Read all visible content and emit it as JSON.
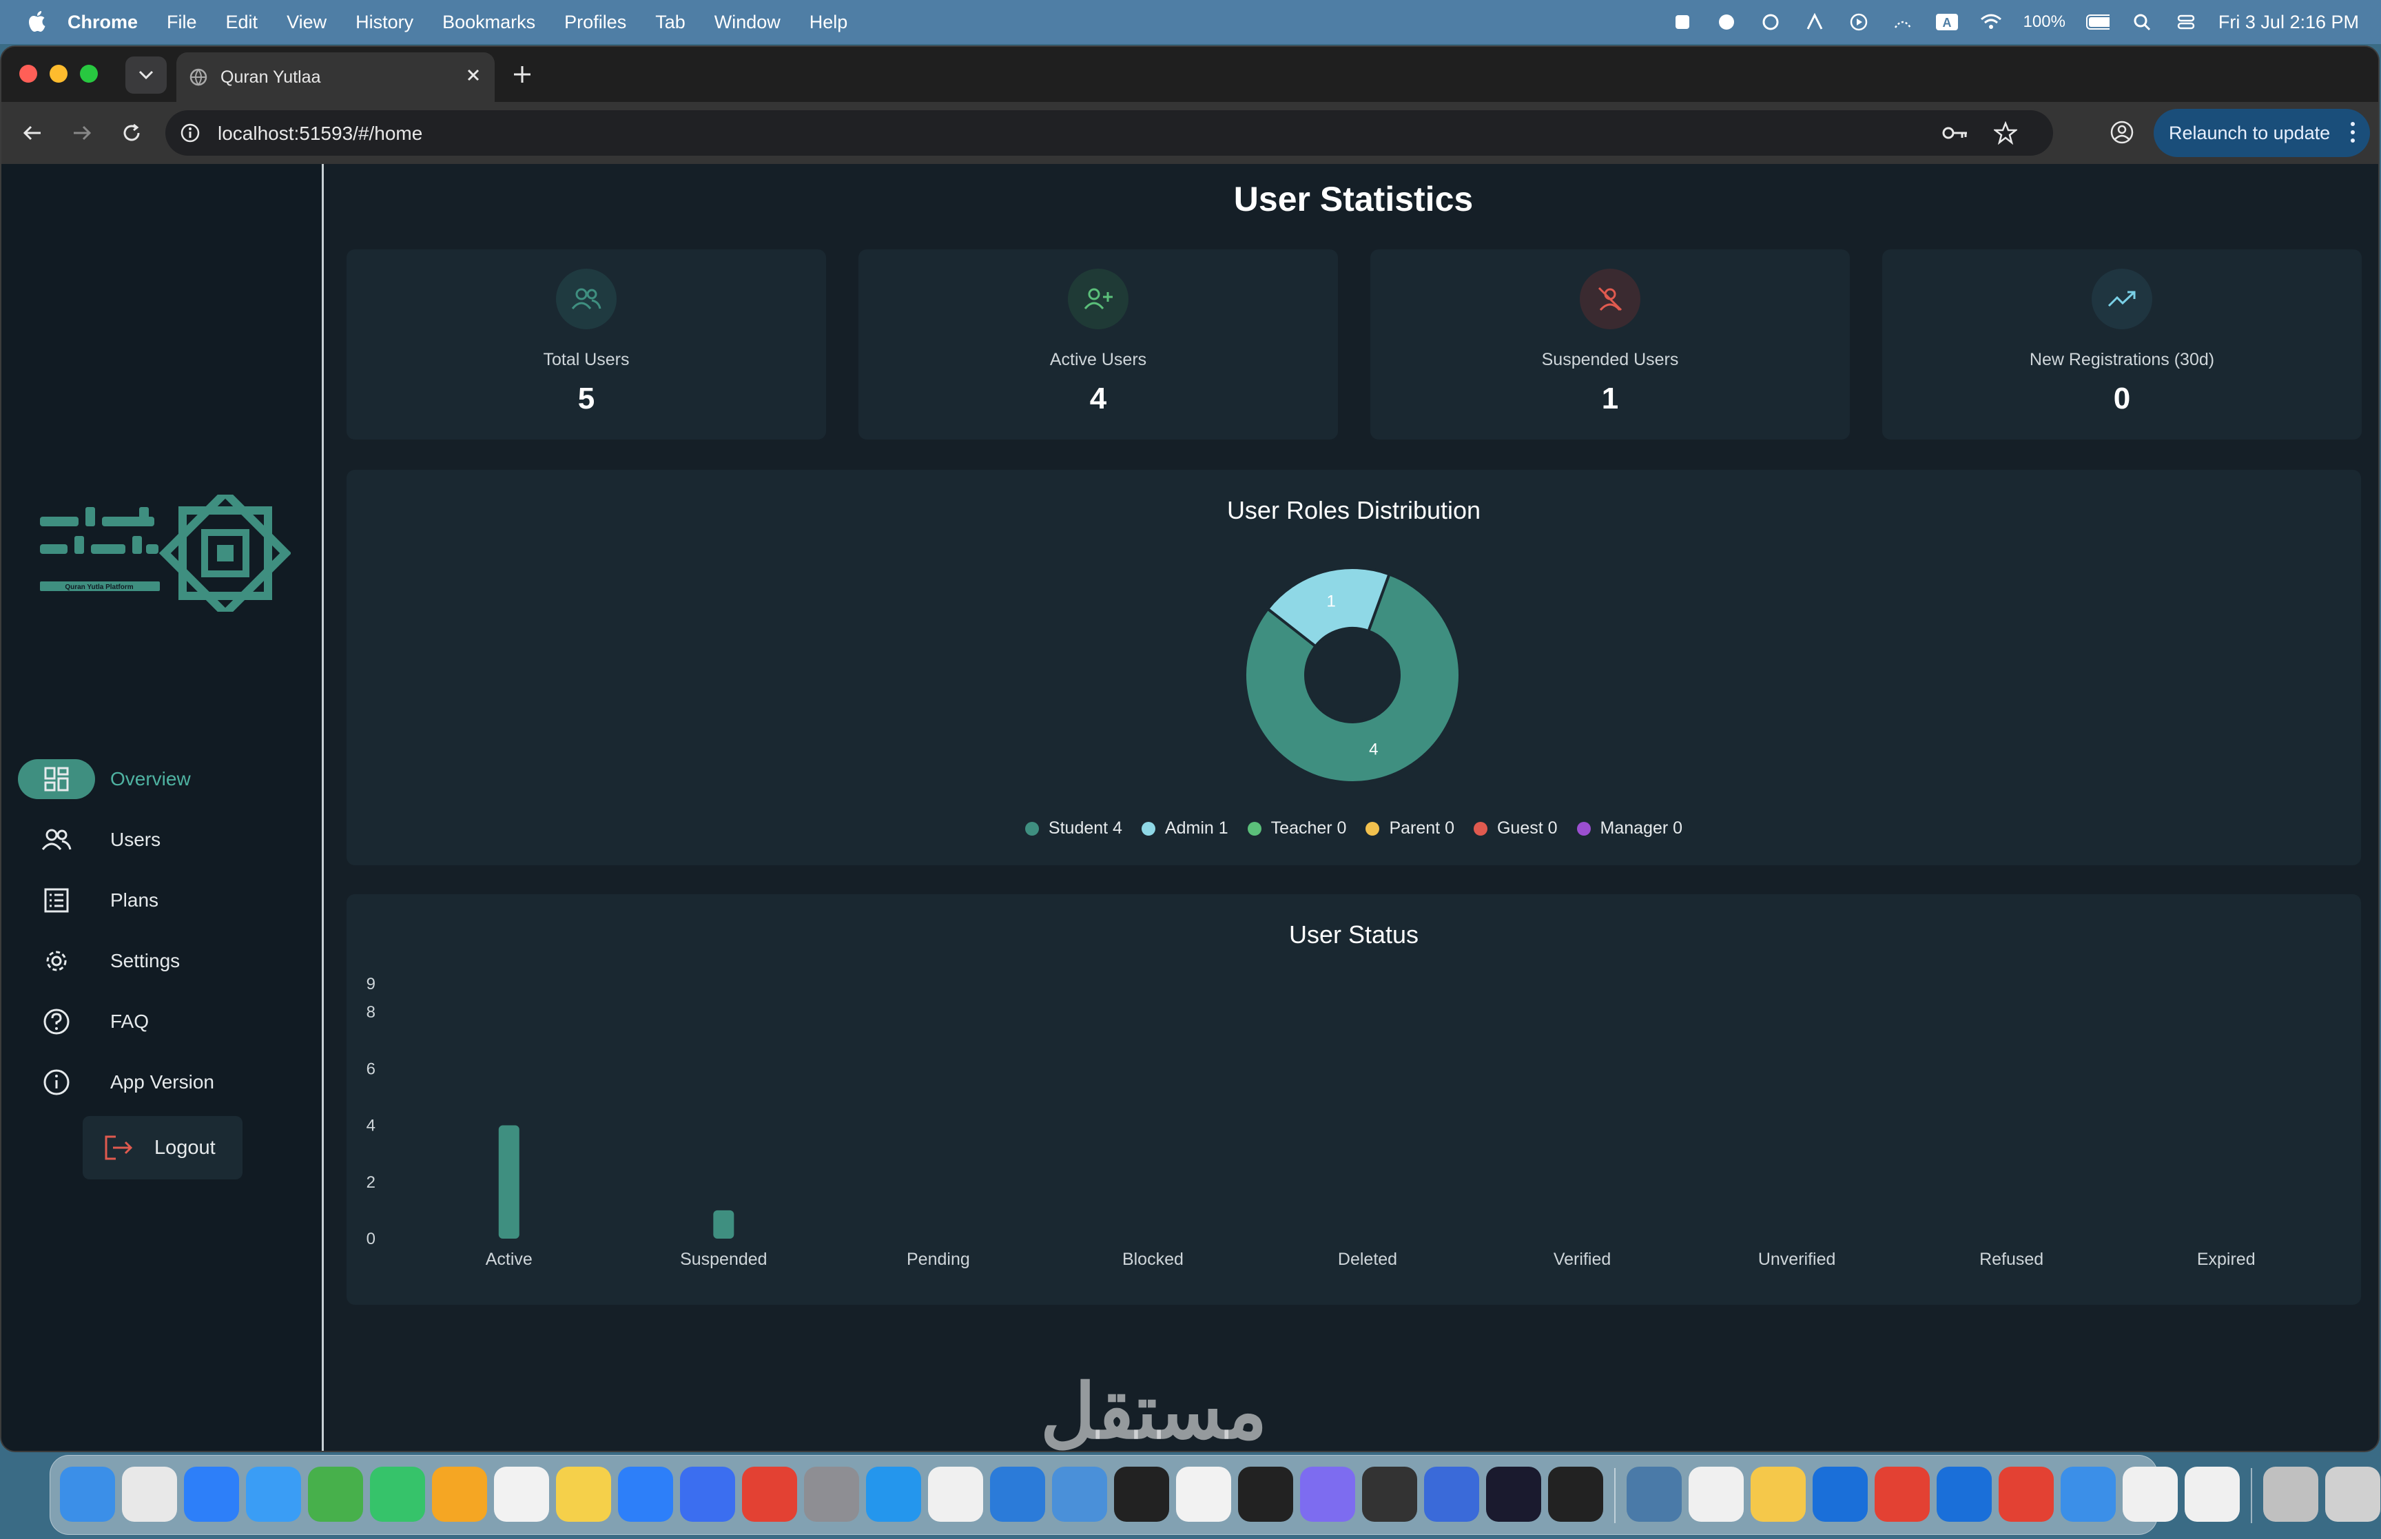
{
  "menubar": {
    "app": "Chrome",
    "menus": [
      "File",
      "Edit",
      "View",
      "History",
      "Bookmarks",
      "Profiles",
      "Tab",
      "Window",
      "Help"
    ],
    "battery": "100%",
    "datetime": "Fri 3 Jul  2:16 PM"
  },
  "browser": {
    "tab_title": "Quran Yutlaa",
    "url": "localhost:51593/#/home",
    "relaunch_label": "Relaunch to update"
  },
  "sidebar": {
    "logo_alt": "Quran Yutla Platform",
    "items": [
      {
        "label": "Overview",
        "icon": "dashboard-icon",
        "active": true
      },
      {
        "label": "Users",
        "icon": "users-icon"
      },
      {
        "label": "Plans",
        "icon": "list-icon"
      },
      {
        "label": "Settings",
        "icon": "gear-icon"
      },
      {
        "label": "FAQ",
        "icon": "help-icon"
      },
      {
        "label": "App Version",
        "icon": "info-icon"
      }
    ],
    "logout_label": "Logout"
  },
  "page": {
    "title": "User Statistics",
    "cards": [
      {
        "label": "Total Users",
        "value": "5",
        "icon": "users-icon",
        "color": "#3f8f80"
      },
      {
        "label": "Active Users",
        "value": "4",
        "icon": "user-plus-icon",
        "color": "#5bbf7a"
      },
      {
        "label": "Suspended Users",
        "value": "1",
        "icon": "user-off-icon",
        "color": "#e05a4f"
      },
      {
        "label": "New Registrations (30d)",
        "value": "0",
        "icon": "trending-up-icon",
        "color": "#7ad0e6"
      }
    ]
  },
  "chart_data": [
    {
      "type": "pie",
      "title": "User Roles Distribution",
      "donut": true,
      "slices": [
        {
          "name": "Student",
          "value": 4,
          "color": "#3f8f80"
        },
        {
          "name": "Admin",
          "value": 1,
          "color": "#8fd8e6"
        },
        {
          "name": "Teacher",
          "value": 0,
          "color": "#5bbf7a"
        },
        {
          "name": "Parent",
          "value": 0,
          "color": "#f2c14e"
        },
        {
          "name": "Guest",
          "value": 0,
          "color": "#e05a4f"
        },
        {
          "name": "Manager",
          "value": 0,
          "color": "#9b4fd0"
        }
      ],
      "legend": [
        "Student 4",
        "Admin 1",
        "Teacher 0",
        "Parent 0",
        "Guest 0",
        "Manager 0"
      ],
      "slice_labels": [
        "4",
        "1"
      ],
      "legend_position": "bottom"
    },
    {
      "type": "bar",
      "title": "User Status",
      "categories": [
        "Active",
        "Suspended",
        "Pending",
        "Blocked",
        "Deleted",
        "Verified",
        "Unverified",
        "Refused",
        "Expired"
      ],
      "values": [
        4,
        1,
        0,
        0,
        0,
        0,
        0,
        0,
        0
      ],
      "yticks": [
        "0",
        "2",
        "4",
        "6",
        "8",
        "9"
      ],
      "ylim": [
        0,
        9
      ],
      "bar_color": "#3f8f80"
    }
  ],
  "watermark": "مستقل"
}
